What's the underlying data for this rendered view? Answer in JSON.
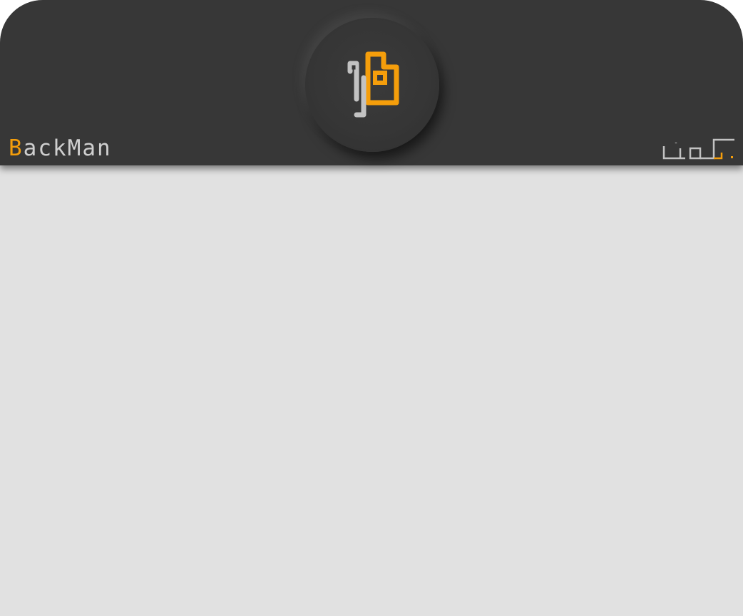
{
  "app": {
    "title_initial": "B",
    "title_rest": "ackMan",
    "colors": {
      "header_background": "#373737",
      "content_background": "#e1e1e1",
      "accent": "#f59e0b",
      "title_text": "#cfcfcf",
      "icon_gray": "#c2c2c2"
    },
    "icons": {
      "logo": "backman-logo-icon",
      "brand_mark": "brand-mark-icon"
    }
  }
}
